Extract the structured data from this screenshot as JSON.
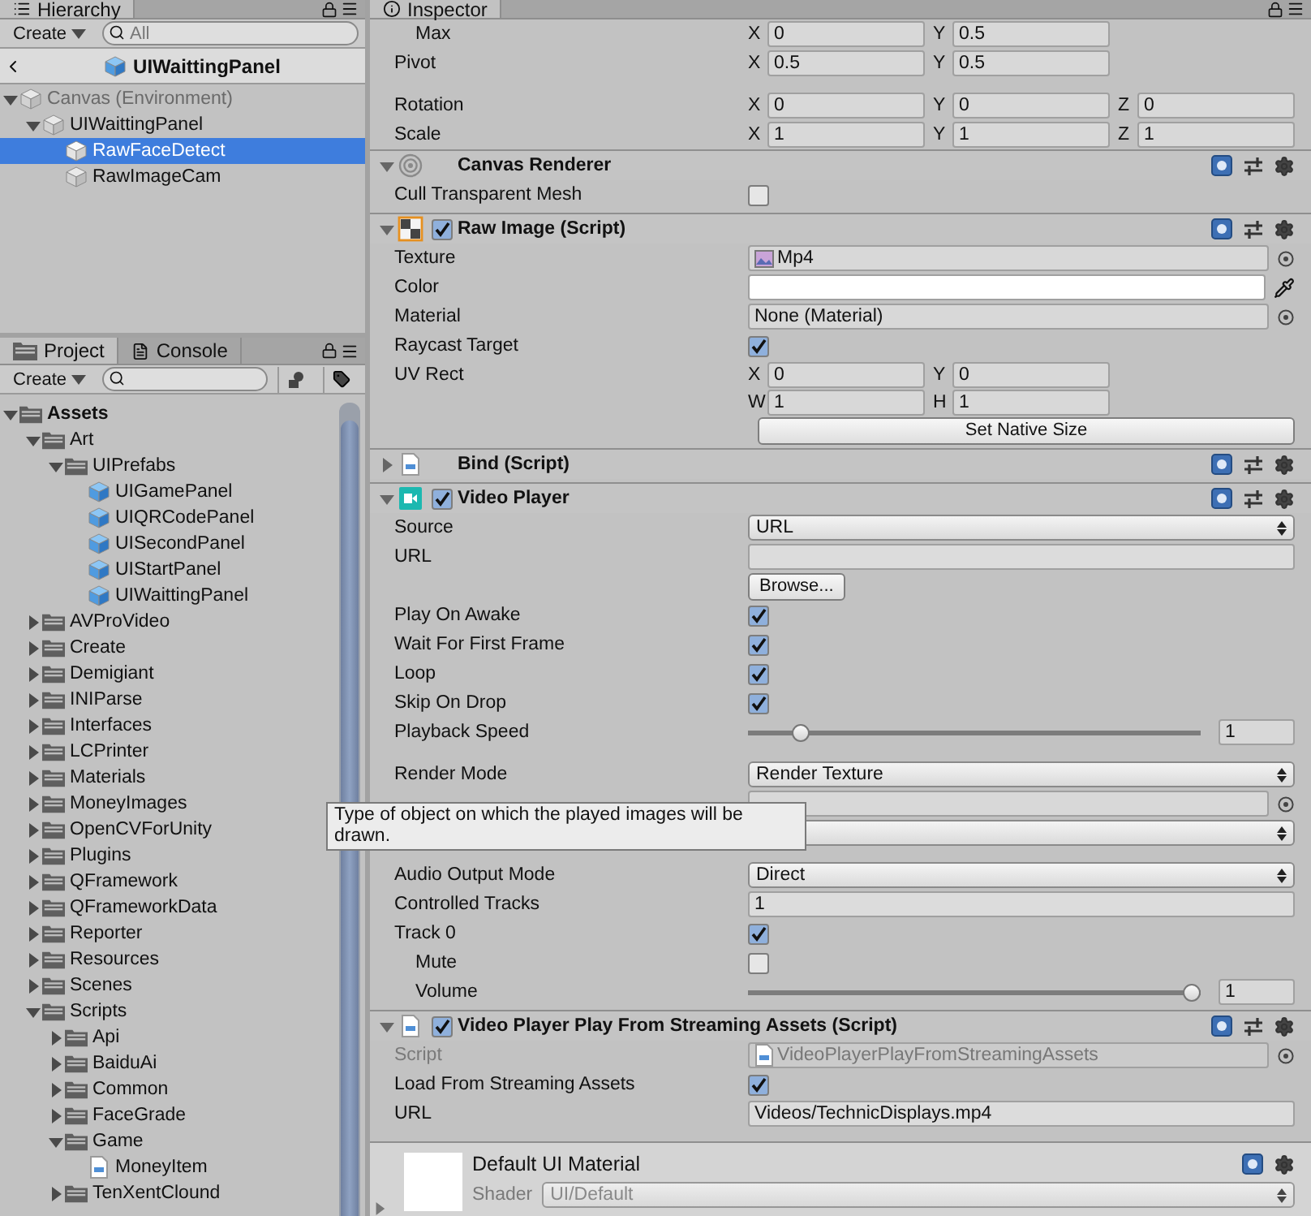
{
  "hierarchy": {
    "tab": "Hierarchy",
    "create": "Create",
    "search_placeholder": "All",
    "scene": "UIWaittingPanel",
    "tree": [
      {
        "label": "Canvas (Environment)",
        "kind": "environment",
        "expanded": true,
        "selected": false,
        "children": [
          {
            "label": "UIWaittingPanel",
            "kind": "object",
            "expanded": true,
            "selected": false,
            "children": [
              {
                "label": "RawFaceDetect",
                "kind": "object",
                "selected": true
              },
              {
                "label": "RawImageCam",
                "kind": "object",
                "selected": false
              }
            ]
          }
        ]
      }
    ]
  },
  "project": {
    "tabs": [
      {
        "label": "Project",
        "kind": "project",
        "selected": true
      },
      {
        "label": "Console",
        "kind": "console",
        "selected": false
      }
    ],
    "create": "Create",
    "tree": [
      {
        "label": "Assets",
        "kind": "folder",
        "expanded": true,
        "selected": false,
        "children": [
          {
            "label": "Art",
            "kind": "folder",
            "expanded": true,
            "selected": false,
            "children": [
              {
                "label": "UIPrefabs",
                "kind": "folder",
                "expanded": true,
                "selected": false,
                "children": [
                  {
                    "label": "UIGamePanel",
                    "kind": "prefab",
                    "selected": false
                  },
                  {
                    "label": "UIQRCodePanel",
                    "kind": "prefab",
                    "selected": false
                  },
                  {
                    "label": "UISecondPanel",
                    "kind": "prefab",
                    "selected": false
                  },
                  {
                    "label": "UIStartPanel",
                    "kind": "prefab",
                    "selected": false
                  },
                  {
                    "label": "UIWaittingPanel",
                    "kind": "prefab",
                    "selected": false
                  }
                ]
              }
            ]
          },
          {
            "label": "AVProVideo",
            "kind": "folder",
            "expanded": false,
            "selected": false
          },
          {
            "label": "Create",
            "kind": "folder",
            "expanded": false,
            "selected": false
          },
          {
            "label": "Demigiant",
            "kind": "folder",
            "expanded": false,
            "selected": false
          },
          {
            "label": "INIParse",
            "kind": "folder",
            "expanded": false,
            "selected": false
          },
          {
            "label": "Interfaces",
            "kind": "folder",
            "expanded": false,
            "selected": false
          },
          {
            "label": "LCPrinter",
            "kind": "folder",
            "expanded": false,
            "selected": false
          },
          {
            "label": "Materials",
            "kind": "folder",
            "expanded": false,
            "selected": false
          },
          {
            "label": "MoneyImages",
            "kind": "folder",
            "expanded": false,
            "selected": false
          },
          {
            "label": "OpenCVForUnity",
            "kind": "folder",
            "expanded": false,
            "selected": false
          },
          {
            "label": "Plugins",
            "kind": "folder",
            "expanded": false,
            "selected": false
          },
          {
            "label": "QFramework",
            "kind": "folder",
            "expanded": false,
            "selected": false
          },
          {
            "label": "QFrameworkData",
            "kind": "folder",
            "expanded": false,
            "selected": false
          },
          {
            "label": "Reporter",
            "kind": "folder",
            "expanded": false,
            "selected": false
          },
          {
            "label": "Resources",
            "kind": "folder",
            "expanded": false,
            "selected": false
          },
          {
            "label": "Scenes",
            "kind": "folder",
            "expanded": false,
            "selected": false
          },
          {
            "label": "Scripts",
            "kind": "folder",
            "expanded": true,
            "selected": false,
            "children": [
              {
                "label": "Api",
                "kind": "folder",
                "expanded": false,
                "selected": false
              },
              {
                "label": "BaiduAi",
                "kind": "folder",
                "expanded": false,
                "selected": false
              },
              {
                "label": "Common",
                "kind": "folder",
                "expanded": false,
                "selected": false
              },
              {
                "label": "FaceGrade",
                "kind": "folder",
                "expanded": false,
                "selected": false
              },
              {
                "label": "Game",
                "kind": "folder",
                "expanded": true,
                "selected": false,
                "children": [
                  {
                    "label": "MoneyItem",
                    "kind": "script",
                    "selected": false
                  }
                ]
              },
              {
                "label": "TenXentClound",
                "kind": "folder",
                "expanded": false,
                "selected": false
              }
            ]
          }
        ]
      }
    ]
  },
  "inspector": {
    "tab": "Inspector",
    "components": [
      {
        "rows": [
          {
            "kind": "vector",
            "label": "Max",
            "indented": true,
            "axes": [
              {
                "axis": "X",
                "value": "0"
              },
              {
                "axis": "Y",
                "value": "0.5"
              }
            ]
          },
          {
            "kind": "vector",
            "label": "Pivot",
            "indented": false,
            "axes": [
              {
                "axis": "X",
                "value": "0.5"
              },
              {
                "axis": "Y",
                "value": "0.5"
              }
            ]
          },
          {
            "kind": "spacer"
          },
          {
            "kind": "vector",
            "label": "Rotation",
            "indented": false,
            "axes": [
              {
                "axis": "X",
                "value": "0"
              },
              {
                "axis": "Y",
                "value": "0"
              },
              {
                "axis": "Z",
                "value": "0"
              }
            ]
          },
          {
            "kind": "vector",
            "label": "Scale",
            "indented": false,
            "axes": [
              {
                "axis": "X",
                "value": "1"
              },
              {
                "axis": "Y",
                "value": "1"
              },
              {
                "axis": "Z",
                "value": "1"
              }
            ]
          }
        ]
      },
      {
        "title": "Canvas Renderer",
        "kind": "canvas",
        "expanded": true,
        "rows": [
          {
            "kind": "checkbox",
            "label": "Cull Transparent Mesh",
            "indented": false,
            "checked": false
          }
        ]
      },
      {
        "title": "Raw Image (Script)",
        "kind": "raw-image",
        "enabled": true,
        "expanded": true,
        "rows": [
          {
            "kind": "texture-object",
            "label": "Texture",
            "value": "Mp4",
            "disabled": false
          },
          {
            "kind": "color",
            "label": "Color",
            "color": "#ffffff"
          },
          {
            "kind": "object",
            "label": "Material",
            "value": "None (Material)",
            "disabled": false
          },
          {
            "kind": "checkbox",
            "label": "Raycast Target",
            "indented": false,
            "checked": true
          },
          {
            "kind": "rect",
            "label": "UV Rect",
            "axes": [
              {
                "axis": "X",
                "value": "0"
              },
              {
                "axis": "Y",
                "value": "0"
              },
              {
                "axis": "W",
                "value": "1"
              },
              {
                "axis": "H",
                "value": "1"
              }
            ]
          },
          {
            "kind": "wide-button",
            "text": "Set Native Size"
          }
        ]
      },
      {
        "title": "Bind (Script)",
        "kind": "script",
        "expanded": false
      },
      {
        "title": "Video Player",
        "kind": "video",
        "enabled": true,
        "expanded": true,
        "rows": [
          {
            "kind": "dropdown",
            "label": "Source",
            "value": "URL"
          },
          {
            "kind": "text",
            "label": "URL"
          },
          {
            "kind": "button",
            "text": "Browse..."
          },
          {
            "kind": "checkbox",
            "label": "Play On Awake",
            "indented": false,
            "checked": true
          },
          {
            "kind": "checkbox",
            "label": "Wait For First Frame",
            "indented": false,
            "checked": true
          },
          {
            "kind": "checkbox",
            "label": "Loop",
            "indented": false,
            "checked": true
          },
          {
            "kind": "checkbox",
            "label": "Skip On Drop",
            "indented": false,
            "checked": true
          },
          {
            "kind": "slider",
            "label": "Playback Speed",
            "indented": false,
            "level": 0.1,
            "value": "1"
          },
          {
            "kind": "spacer"
          },
          {
            "kind": "dropdown",
            "label": "Render Mode",
            "value": "Render Texture"
          },
          {
            "kind": "object",
            "disabled": false
          },
          {
            "kind": "dropdown"
          },
          {
            "kind": "spacer"
          },
          {
            "kind": "dropdown",
            "label": "Audio Output Mode",
            "value": "Direct"
          },
          {
            "kind": "text",
            "label": "Controlled Tracks",
            "value": "1"
          },
          {
            "kind": "checkbox",
            "label": "Track 0",
            "indented": false,
            "checked": true
          },
          {
            "kind": "checkbox",
            "label": "Mute",
            "indented": true,
            "checked": false
          },
          {
            "kind": "slider",
            "label": "Volume",
            "indented": true,
            "level": 1,
            "value": "1"
          }
        ]
      },
      {
        "title": "Video Player Play From Streaming Assets (Script)",
        "kind": "script",
        "enabled": true,
        "expanded": true,
        "rows": [
          {
            "kind": "script-object",
            "label": "Script",
            "value": "VideoPlayerPlayFromStreamingAssets",
            "disabled": true
          },
          {
            "kind": "checkbox",
            "label": "Load From Streaming Assets",
            "indented": false,
            "checked": true
          },
          {
            "kind": "text",
            "label": "URL",
            "value": "Videos/TechnicDisplays.mp4"
          }
        ]
      }
    ],
    "material": {
      "title": "Default UI Material",
      "shader_label": "Shader",
      "shader": "UI/Default"
    }
  },
  "tooltip": {
    "text": "Type of object on which the played images will be drawn."
  }
}
